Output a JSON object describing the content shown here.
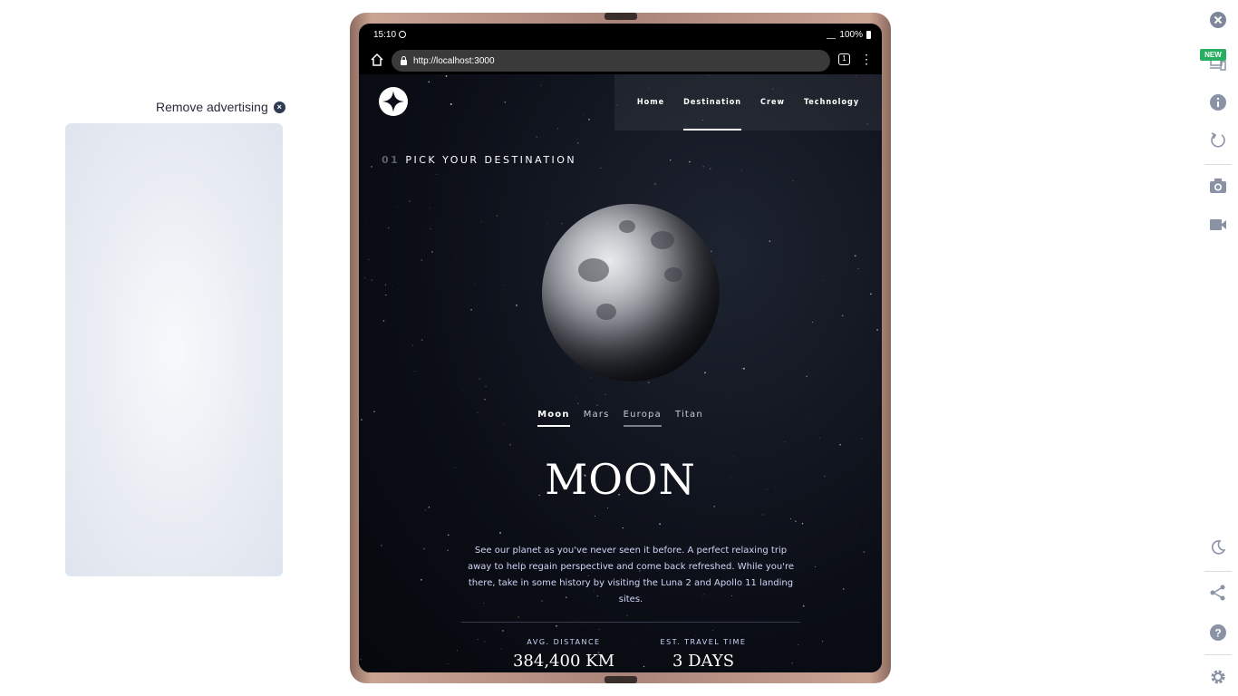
{
  "ad": {
    "remove_label": "Remove advertising"
  },
  "device": {
    "status_time": "15:10",
    "battery": "100%",
    "url": "http://localhost:3000",
    "tab_count": "1"
  },
  "site": {
    "nav": [
      {
        "label": "Home"
      },
      {
        "label": "Destination",
        "active": true
      },
      {
        "label": "Crew"
      },
      {
        "label": "Technology"
      }
    ],
    "heading_number": "01",
    "heading_text": "PICK YOUR DESTINATION",
    "destinations": [
      {
        "label": "Moon",
        "active": true
      },
      {
        "label": "Mars"
      },
      {
        "label": "Europa"
      },
      {
        "label": "Titan"
      }
    ],
    "title": "MOON",
    "description": "See our planet as you've never seen it before. A perfect relaxing trip away to help regain perspective and come back refreshed. While you're there, take in some history by visiting the Luna 2 and Apollo 11 landing sites.",
    "stats": [
      {
        "label": "AVG. DISTANCE",
        "value": "384,400 KM"
      },
      {
        "label": "EST. TRAVEL TIME",
        "value": "3 DAYS"
      }
    ]
  },
  "toolbar": {
    "new_badge": "NEW",
    "icons": [
      "close-icon",
      "devices-icon",
      "info-icon",
      "rotate-icon",
      "camera-icon",
      "video-icon",
      "dark-mode-icon",
      "share-icon",
      "help-icon",
      "settings-icon"
    ]
  },
  "colors": {
    "page_bg": "#0b0e16",
    "accent_text": "#d0d6f9",
    "badge": "#27ae60",
    "toolbar_icon": "#8a93a6"
  }
}
